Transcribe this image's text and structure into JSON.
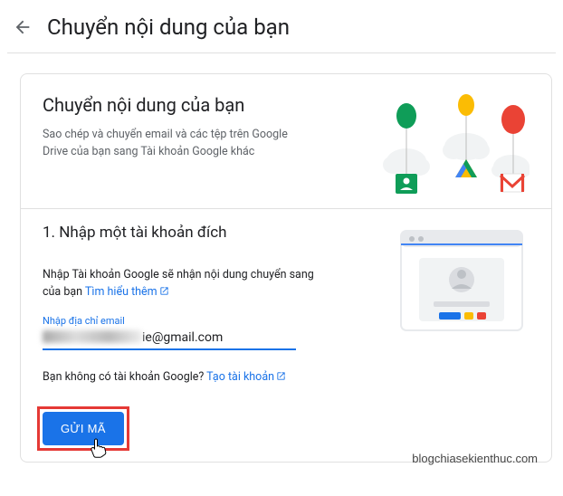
{
  "header": {
    "title": "Chuyển nội dung của bạn"
  },
  "card": {
    "title": "Chuyển nội dung của bạn",
    "subtitle": "Sao chép và chuyển email và các tệp trên Google Drive của bạn sang Tài khoản Google khác"
  },
  "step1": {
    "heading": "1. Nhập một tài khoản đích",
    "desc_prefix": "Nhập Tài khoản Google sẽ nhận nội dung chuyển sang của bạn ",
    "learn_more": "Tìm hiểu thêm",
    "input_label": "Nhập địa chỉ email",
    "email_visible_suffix": "ie@gmail.com",
    "no_account_prefix": "Bạn không có tài khoản Google? ",
    "create_account": "Tạo tài khoản",
    "submit_label": "GỬI MÃ"
  },
  "watermark": "blogchiasekienthuc.com"
}
